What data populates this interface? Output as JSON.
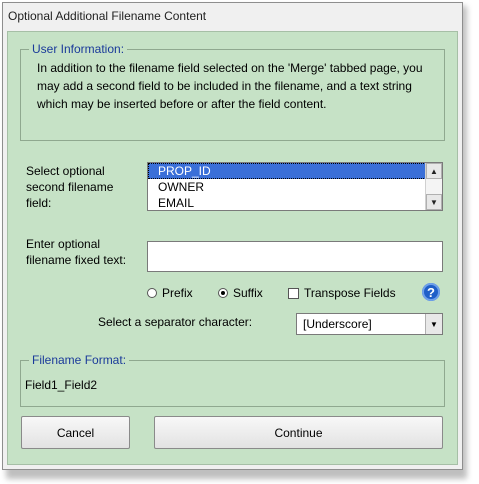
{
  "window": {
    "title": "Optional Additional Filename Content"
  },
  "user_info": {
    "legend": "User Information:",
    "text": "In addition to the filename field selected on the 'Merge' tabbed page, you may add a second field to be included in the filename, and a text string which may be inserted before or after the field content."
  },
  "second_field": {
    "label": "Select optional second filename field:",
    "items": [
      "PROP_ID",
      "OWNER",
      "EMAIL"
    ],
    "selected": "PROP_ID"
  },
  "fixed_text": {
    "label": "Enter optional filename fixed text:",
    "value": ""
  },
  "position": {
    "prefix_label": "Prefix",
    "suffix_label": "Suffix",
    "selected": "Suffix"
  },
  "transpose": {
    "label": "Transpose Fields",
    "checked": false
  },
  "help": {
    "glyph": "?"
  },
  "separator": {
    "label": "Select a separator character:",
    "value": "[Underscore]"
  },
  "filename_format": {
    "legend": "Filename Format:",
    "value": "Field1_Field2"
  },
  "buttons": {
    "cancel": "Cancel",
    "continue": "Continue"
  },
  "colors": {
    "client_bg": "#c6e2c6",
    "legend_text": "#1a3a9a",
    "selection": "#3a6fd8"
  }
}
